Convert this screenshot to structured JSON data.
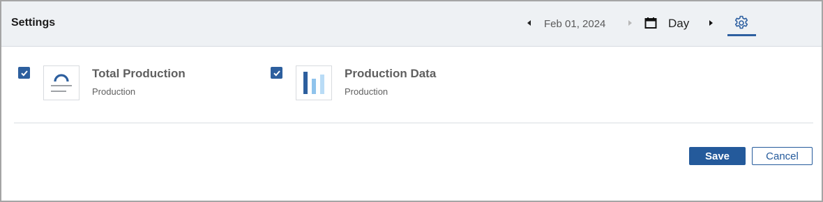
{
  "header": {
    "title": "Settings",
    "date": "Feb 01, 2024",
    "period": "Day",
    "prev_icon": "caret-left-icon",
    "next_date_icon": "caret-right-icon",
    "calendar_icon": "calendar-icon",
    "next_period_icon": "caret-right-icon",
    "settings_icon": "gear-icon"
  },
  "widgets": [
    {
      "title": "Total Production",
      "subtitle": "Production",
      "checked": true,
      "icon": "gauge-icon"
    },
    {
      "title": "Production Data",
      "subtitle": "Production",
      "checked": true,
      "icon": "bar-chart-icon"
    }
  ],
  "actions": {
    "save_label": "Save",
    "cancel_label": "Cancel"
  },
  "colors": {
    "accent": "#245a9b",
    "header_bg": "#eef1f4",
    "text_muted": "#5f5f5f"
  }
}
